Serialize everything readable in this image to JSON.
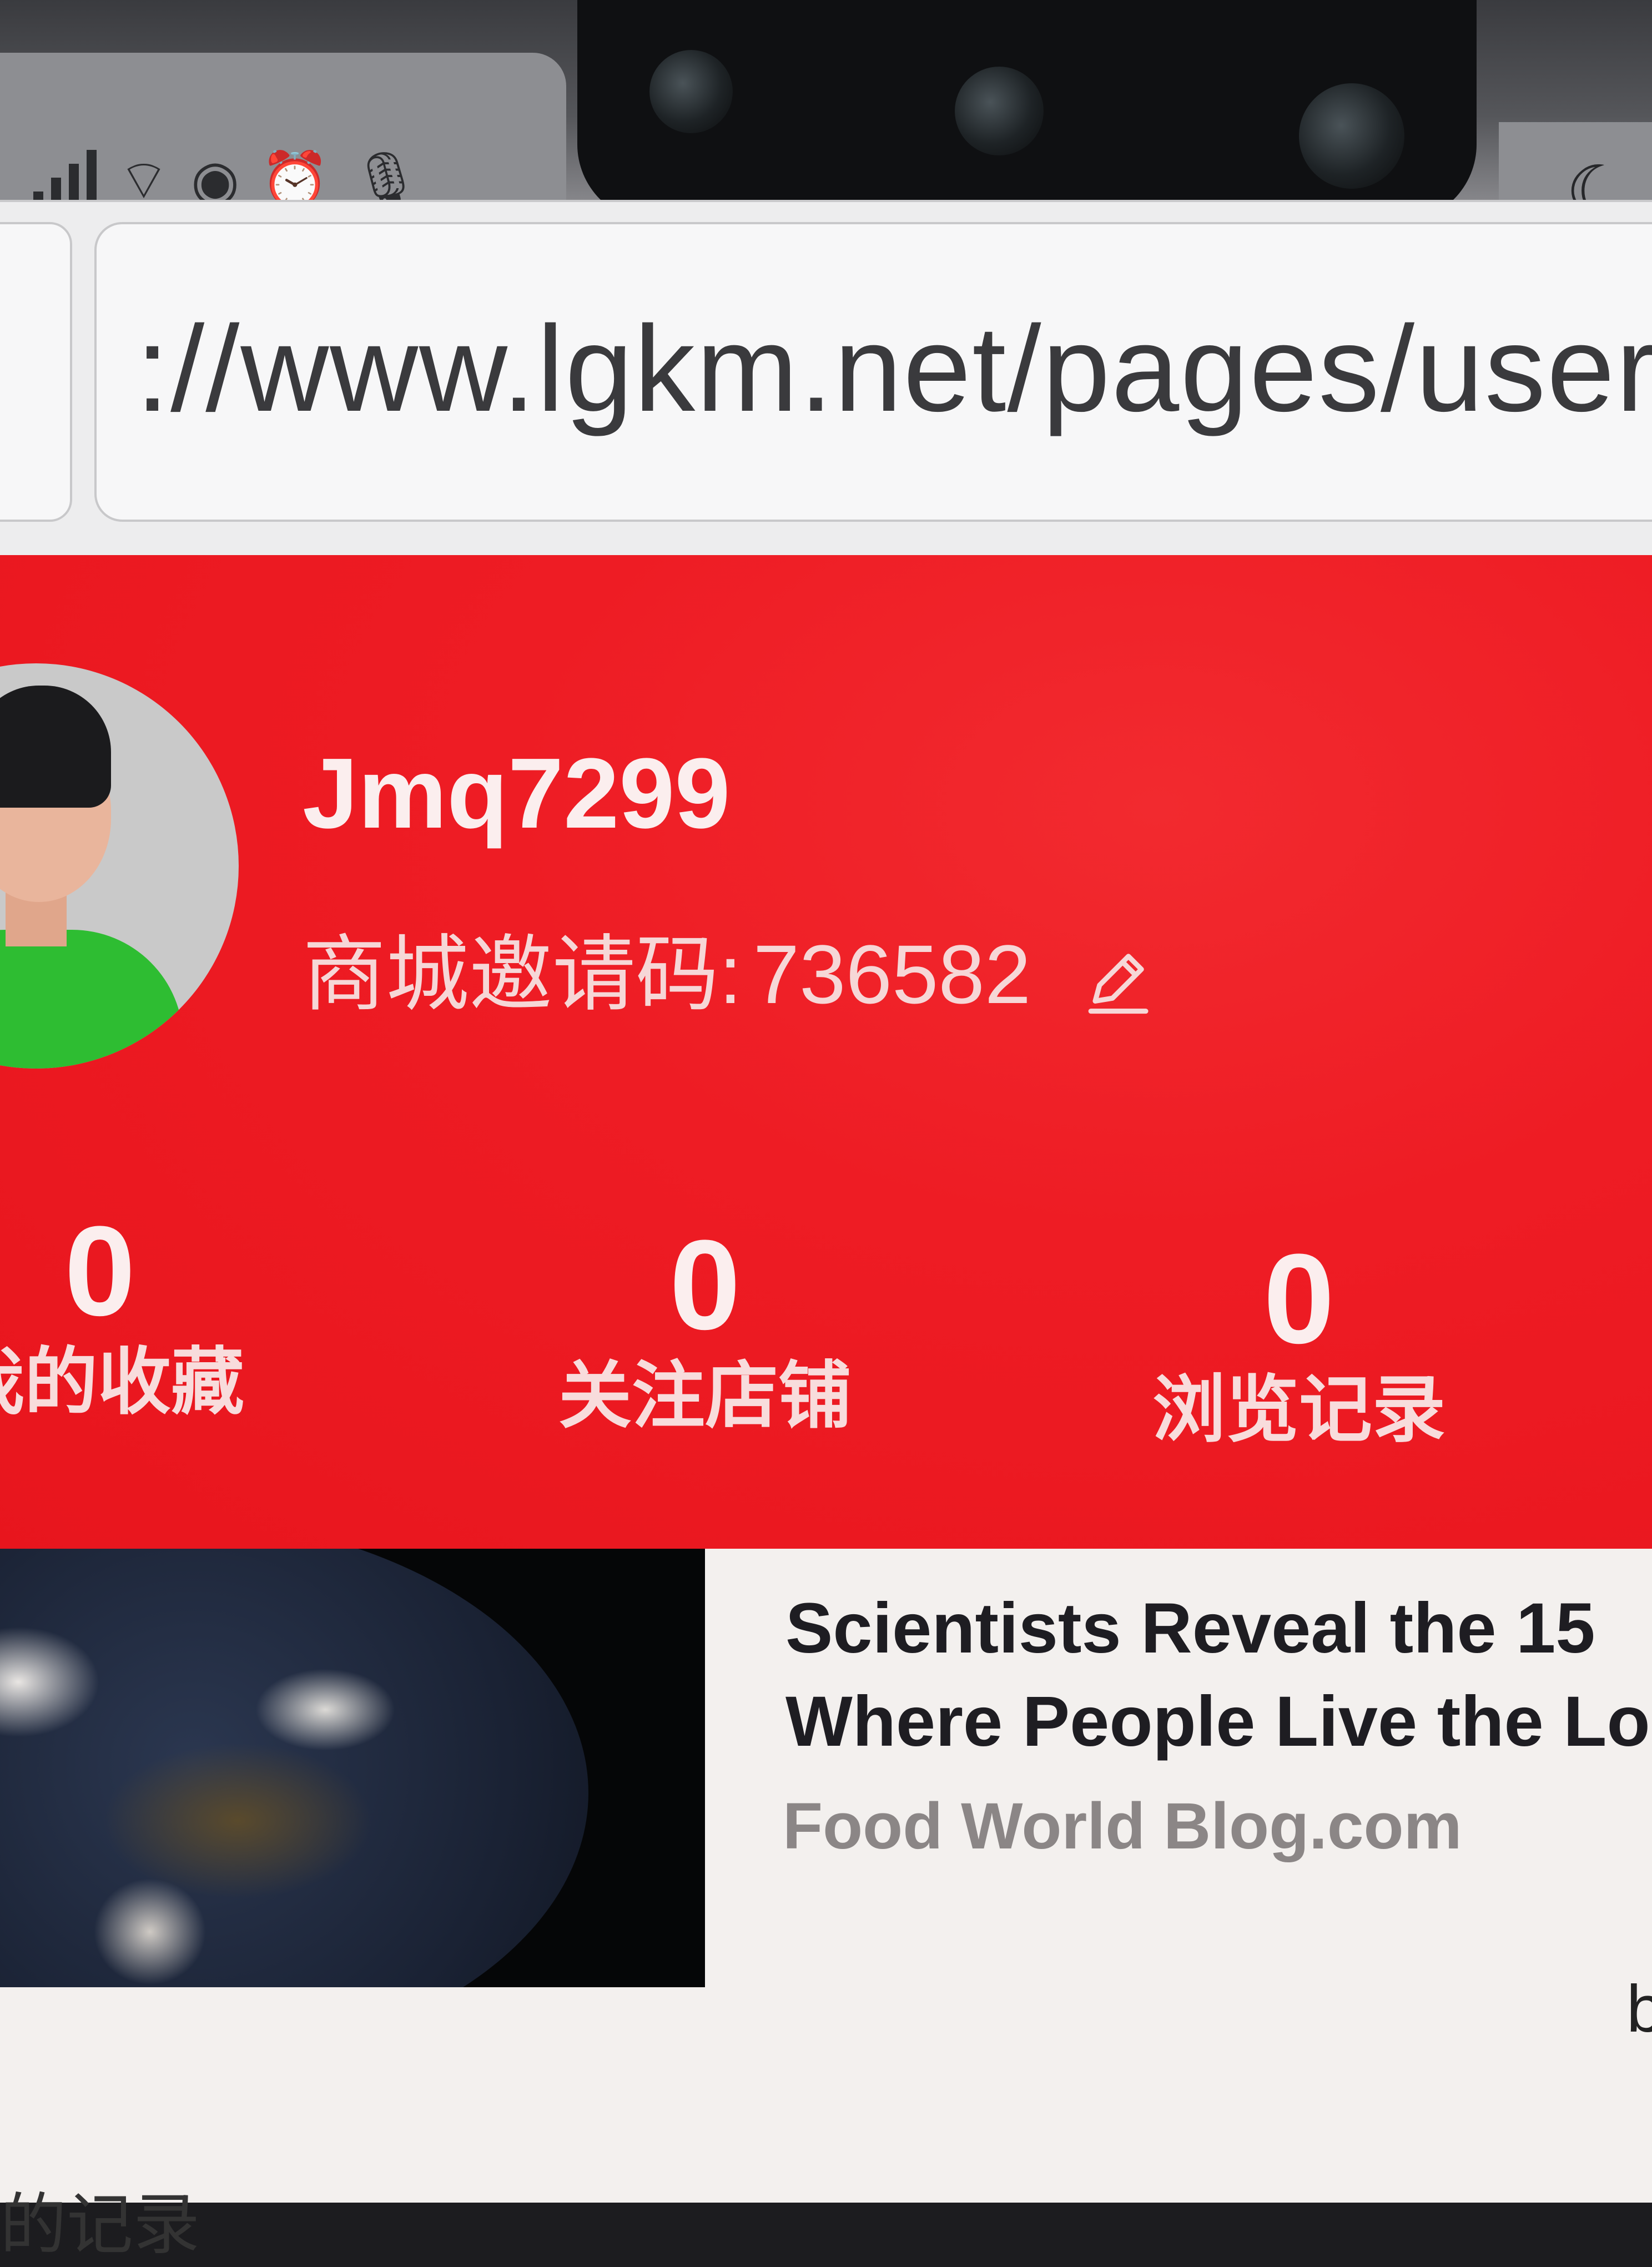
{
  "status_bar": {
    "icons": [
      "signal-icon",
      "wifi-icon",
      "eye-icon",
      "alarm-icon",
      "microphone-icon",
      "moon-icon"
    ]
  },
  "browser": {
    "url": "://www.lgkm.net/pages/user/i"
  },
  "profile": {
    "username": "Jmq7299",
    "invite_label": "商城邀请码:",
    "invite_code": "736582",
    "accent_color": "#ee1c24"
  },
  "stats": [
    {
      "value": "0",
      "label": "我的收藏"
    },
    {
      "value": "0",
      "label": "关注店铺"
    },
    {
      "value": "0",
      "label": "浏览记录"
    }
  ],
  "ad_card": {
    "title_line1": "Scientists Reveal the 15",
    "title_line2": "Where People Live the Lo",
    "source": "Food World Blog.com",
    "trailing_fragment": "b"
  },
  "bottom_fragment": "的记录"
}
